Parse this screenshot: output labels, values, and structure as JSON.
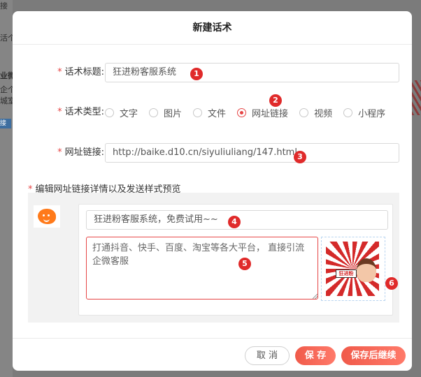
{
  "background": {
    "text_1": "接",
    "text_2": "活个",
    "text_3": "业微",
    "text_4": "企个",
    "text_5": "城室",
    "badge": "接"
  },
  "modal": {
    "title": "新建话术",
    "fields": {
      "title_label": "话术标题:",
      "title_value": "狂进粉客服系统",
      "type_label": "话术类型:",
      "type_options": [
        "文字",
        "图片",
        "文件",
        "网址链接",
        "视频",
        "小程序"
      ],
      "type_selected": "网址链接",
      "url_label": "网址链接:",
      "url_value": "http://baike.d10.cn/siyuliuliang/147.html"
    },
    "preview": {
      "section_title": "编辑网址链接详情以及发送样式预览",
      "card_title": "狂进粉客服系统，免费试用~~",
      "card_desc": "打通抖音、快手、百度、淘宝等各大平台， 直接引流企微客服",
      "thumb_sign": "狂进粉"
    },
    "buttons": {
      "cancel": "取 消",
      "save": "保 存",
      "save_continue": "保存后继续"
    }
  },
  "markers": [
    "1",
    "2",
    "3",
    "4",
    "5",
    "6"
  ],
  "colors": {
    "accent": "#e64545",
    "marker": "#e02a2a",
    "overlay": "#7b7b7b"
  }
}
